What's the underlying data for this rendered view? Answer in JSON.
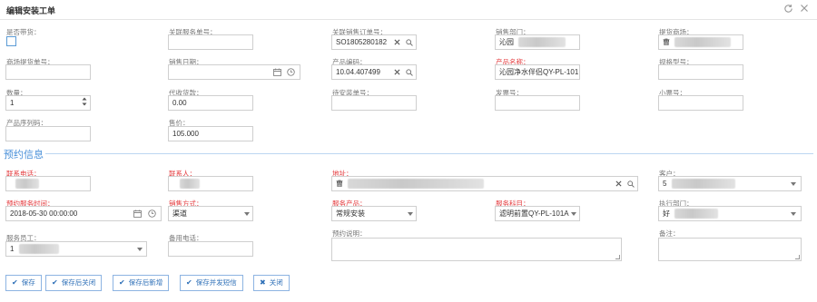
{
  "window": {
    "title": "编辑安装工单",
    "refresh_icon": "refresh-icon",
    "close_icon": "close-icon"
  },
  "row1": {
    "has_goods_label": "是否带货：",
    "related_service_label": "关联服务单号：",
    "related_service_value": "",
    "related_sales_label": "关联销售订单号：",
    "related_sales_value": "SO1805280182",
    "sales_dept_label": "销售部门：",
    "sales_dept_value": "沁园",
    "mall_label": "提货商场：",
    "mall_value": "曹"
  },
  "row2": {
    "mall_pickup_label": "商场提货单号：",
    "mall_pickup_value": "",
    "sales_date_label": "销售日期：",
    "sales_date_value": "",
    "product_code_label": "产品编码：",
    "product_code_value": "10.04.407499",
    "product_name_label": "产品名称：",
    "product_name_value": "沁园净水伴侣QY-PL-101",
    "spec_label": "规格型号：",
    "spec_value": ""
  },
  "row3": {
    "qty_label": "数量：",
    "qty_value": "1",
    "cod_label": "代收货款：",
    "cod_value": "0.00",
    "pending_install_label": "待安装单号：",
    "pending_install_value": "",
    "invoice_label": "发票号：",
    "invoice_value": "",
    "ticket_label": "小票号：",
    "ticket_value": ""
  },
  "row4": {
    "serial_label": "产品序列码：",
    "serial_value": "",
    "price_label": "售价：",
    "price_value": "105.000"
  },
  "reservation": {
    "section_title": "预约信息",
    "phone_label": "联系电话：",
    "contact_label": "联系人：",
    "address_label": "地址：",
    "address_value": "曹",
    "customer_label": "客户：",
    "customer_value": "5",
    "service_time_label": "预约服务时间：",
    "service_time_value": "2018-05-30 00:00:00",
    "sales_method_label": "销售方式：",
    "sales_method_value": "渠道",
    "service_product_label": "服务产品：",
    "service_product_value": "常规安装",
    "service_item_label": "服务科目：",
    "service_item_value": "滤明前置QY-PL-101A",
    "exec_dept_label": "执行部门：",
    "exec_dept_value": "好",
    "staff_label": "服务员工：",
    "staff_value": "1",
    "backup_phone_label": "备用电话：",
    "backup_phone_value": "",
    "note_label": "预约说明：",
    "remark_label": "备注："
  },
  "buttons": {
    "save": "保存",
    "save_close": "保存后关闭",
    "save_new": "保存后新增",
    "save_sms": "保存并发短信",
    "close": "关闭"
  }
}
